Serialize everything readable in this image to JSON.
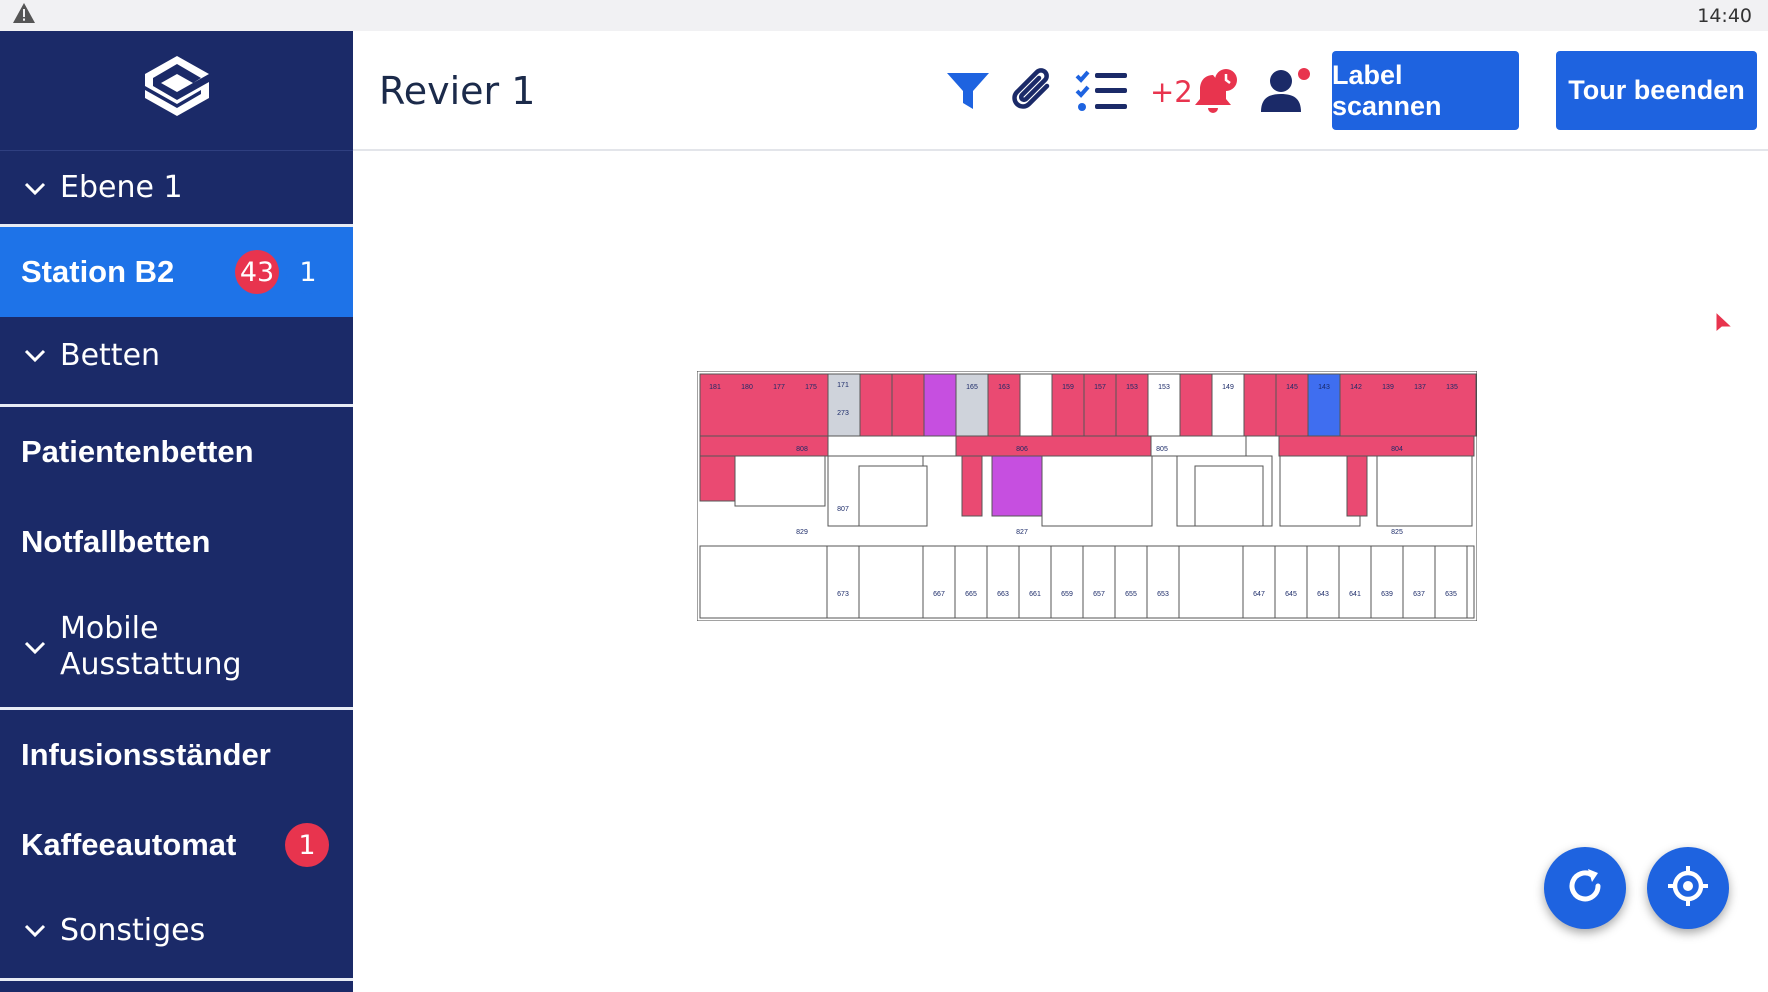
{
  "status_bar": {
    "time": "14:40",
    "warning_icon": "warning-triangle-icon"
  },
  "header": {
    "title": "Revier 1",
    "alert_count": "+2",
    "scan_label": "Label scannen",
    "end_tour_label": "Tour beenden",
    "icons": [
      "filter-icon",
      "paperclip-icon",
      "checklist-icon",
      "alarm-bell-icon",
      "user-notification-icon"
    ]
  },
  "sidebar": {
    "logo_icon": "app-logo-icon",
    "ebene": "Ebene 1",
    "station": {
      "label": "Station B2",
      "badge_red": "43",
      "badge_blue": "1"
    },
    "betten": "Betten",
    "patientenbetten": "Patientenbetten",
    "notfallbetten": "Notfallbetten",
    "mobile_1": "Mobile",
    "mobile_2": "Ausstattung",
    "infusion": "Infusionsständer",
    "kaffee": {
      "label": "Kaffeeautomat",
      "badge": "1"
    },
    "sonstiges": "Sonstiges"
  },
  "map": {
    "top_rooms": [
      "181",
      "180",
      "177",
      "175",
      "171",
      "273",
      "165",
      "163",
      "159",
      "157",
      "153",
      "153",
      "149",
      "145",
      "143",
      "142",
      "139",
      "137",
      "135"
    ],
    "corridor_labels": [
      "808",
      "807",
      "806",
      "805",
      "804",
      "829",
      "827",
      "825"
    ],
    "bottom_rooms": [
      "673",
      "667",
      "665",
      "663",
      "661",
      "659",
      "657",
      "655",
      "653",
      "647",
      "645",
      "643",
      "641",
      "639",
      "637",
      "635"
    ],
    "colors": {
      "occupied": "#ea4a72",
      "special": "#c64fe0",
      "grey": "#cfd3db",
      "selected": "#3f6ef0"
    }
  },
  "fabs": {
    "refresh_icon": "refresh-icon",
    "locate_icon": "crosshair-locate-icon"
  }
}
